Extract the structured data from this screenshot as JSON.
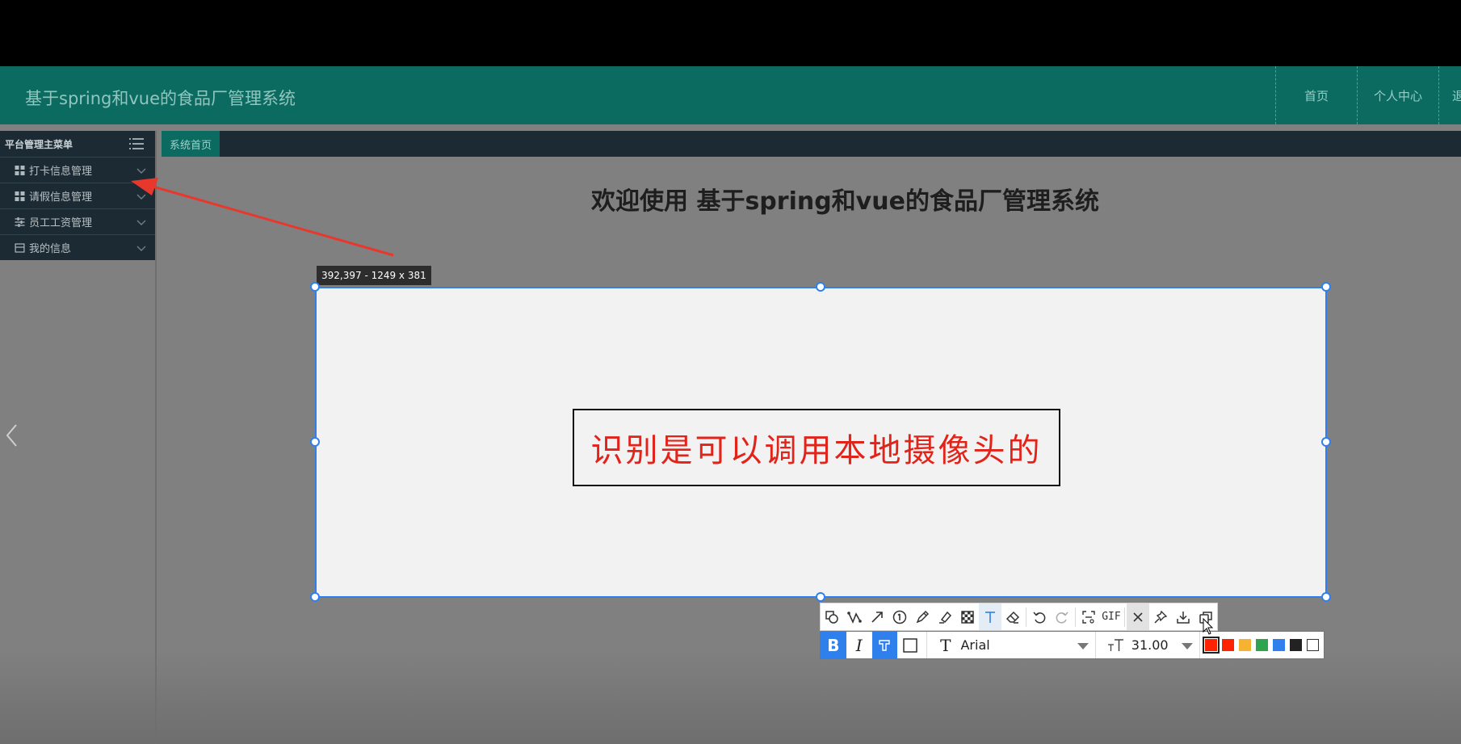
{
  "header": {
    "title": "基于spring和vue的食品厂管理系统",
    "nav": [
      "首页",
      "个人中心",
      "退"
    ]
  },
  "sidebar": {
    "heading": "平台管理主菜单",
    "items": [
      {
        "label": "打卡信息管理",
        "icon": "grid-icon"
      },
      {
        "label": "请假信息管理",
        "icon": "grid-icon"
      },
      {
        "label": "员工工资管理",
        "icon": "sliders-icon"
      },
      {
        "label": "我的信息",
        "icon": "card-icon"
      }
    ]
  },
  "tabs": {
    "home": "系统首页"
  },
  "main": {
    "welcome": "欢迎使用 基于spring和vue的食品厂管理系统"
  },
  "capture": {
    "readout": "392,397 - 1249 x 381",
    "annotation_text": "识别是可以调用本地摄像头的",
    "annotation_color": "#e2231a",
    "tools": [
      "shape-icon",
      "polyline-icon",
      "arrow-icon",
      "number-marker-icon",
      "pen-icon",
      "highlighter-icon",
      "mosaic-icon",
      "text-icon",
      "eraser-icon",
      "undo-icon",
      "redo-icon",
      "ocr-icon",
      "gif-icon",
      "close-icon",
      "pin-icon",
      "download-icon",
      "copy-icon"
    ],
    "text_tools": {
      "bold": "B",
      "italic": "I",
      "font_icon": "T",
      "font": "Arial",
      "size": "31.00",
      "active_color": "#ff2200",
      "palette": [
        "#ff2200",
        "#f6b233",
        "#2ea44f",
        "#2f80ed",
        "#222222",
        "#ffffff"
      ]
    },
    "gif_label": "GIF"
  },
  "colors": {
    "header_bg": "#0c6b61",
    "sidebar_bg": "#1c2a33",
    "selection_border": "#2f80ed",
    "arrow": "#e8372c"
  }
}
